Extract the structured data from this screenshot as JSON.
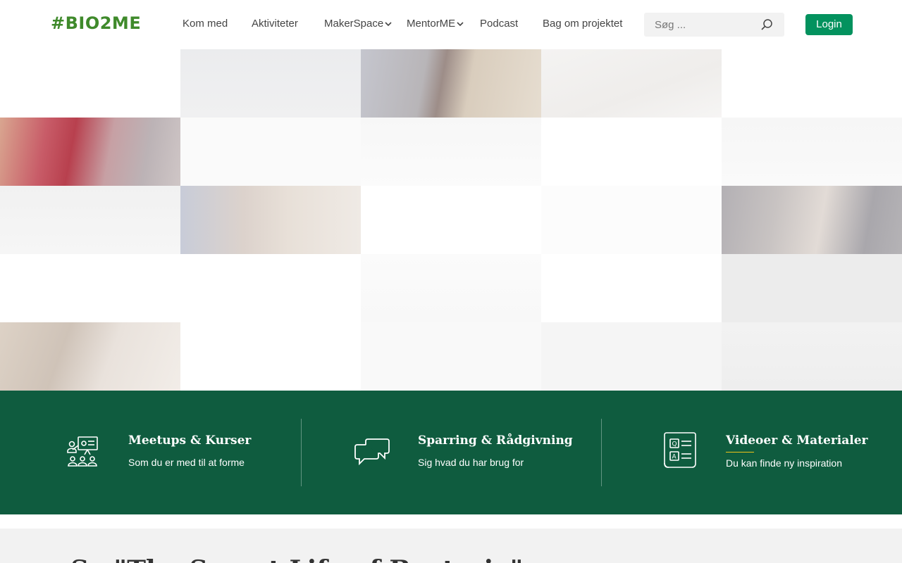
{
  "header": {
    "logo": "#BIO2ME",
    "nav": [
      {
        "label": "Kom med"
      },
      {
        "label": "Aktiviteter"
      },
      {
        "label": "MakerSpace"
      },
      {
        "label": "MentorME"
      },
      {
        "label": "Podcast"
      },
      {
        "label": "Bag om projektet"
      }
    ],
    "search_placeholder": "Søg ...",
    "login_label": "Login"
  },
  "features": [
    {
      "title": "Meetups & Kurser",
      "subtitle": "Som du er med til at forme",
      "icon": "presentation-audience-icon"
    },
    {
      "title": "Sparring & Rådgivning",
      "subtitle": "Sig hvad du har brug for",
      "icon": "chat-bubbles-icon"
    },
    {
      "title": "Videoer & Materialer",
      "subtitle": "Du kan finde ny inspiration",
      "icon": "qa-document-icon"
    }
  ],
  "lower_heading": "Se \"The Secret Life of Bacteria\" og ...",
  "colors": {
    "brand_green": "#3f8a2b",
    "button_green": "#03925e",
    "band_green": "#0f5c3f",
    "accent_yellow": "#f0c419"
  }
}
